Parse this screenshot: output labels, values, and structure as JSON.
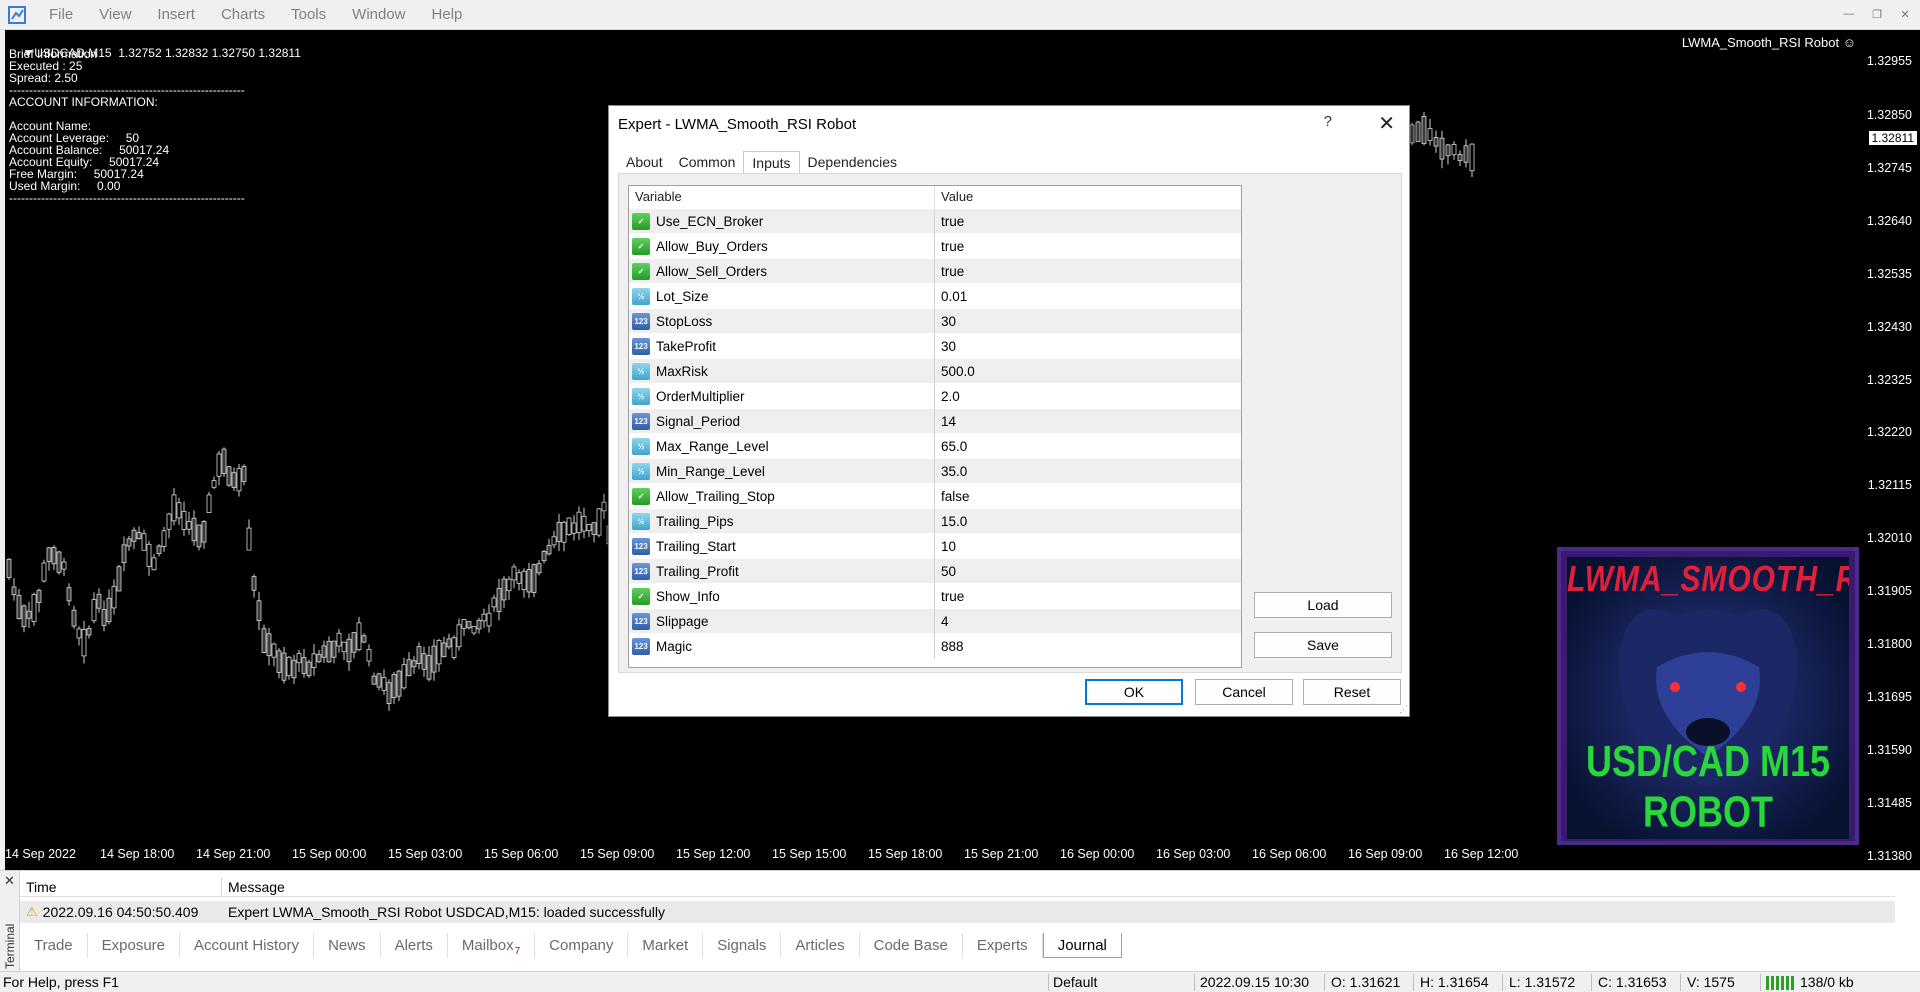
{
  "menubar": {
    "items": [
      "File",
      "View",
      "Insert",
      "Charts",
      "Tools",
      "Window",
      "Help"
    ]
  },
  "chart": {
    "header": "USDCAD,M15  1.32752 1.32832 1.32750 1.32811",
    "info_lines": [
      "Brief Information",
      "Executed : 25",
      "Spread: 2.50",
      "-----------------------------------------------------------",
      "ACCOUNT INFORMATION:",
      "",
      "Account Name:",
      "Account Leverage:     50",
      "Account Balance:     50017.24",
      "Account Equity:     50017.24",
      "Free Margin:     50017.24",
      "Used Margin:     0.00",
      "-----------------------------------------------------------"
    ],
    "ea_label": "LWMA_Smooth_RSI Robot ☺",
    "current_price": "1.32811",
    "price_scale": [
      "1.32955",
      "1.32850",
      "1.32745",
      "1.32640",
      "1.32535",
      "1.32430",
      "1.32325",
      "1.32220",
      "1.32115",
      "1.32010",
      "1.31905",
      "1.31800",
      "1.31695",
      "1.31590",
      "1.31485",
      "1.31380"
    ],
    "time_scale": [
      "14 Sep 2022",
      "14 Sep 18:00",
      "14 Sep 21:00",
      "15 Sep 00:00",
      "15 Sep 03:00",
      "15 Sep 06:00",
      "15 Sep 09:00",
      "15 Sep 12:00",
      "15 Sep 15:00",
      "15 Sep 18:00",
      "15 Sep 21:00",
      "16 Sep 00:00",
      "16 Sep 03:00",
      "16 Sep 06:00",
      "16 Sep 09:00",
      "16 Sep 12:00"
    ],
    "banner": {
      "title": "LWMA_SMOOTH_RSI",
      "subtitle": "USD/CAD M15 ROBOT"
    },
    "colors": {
      "background": "#000000",
      "candle": "#ffffff",
      "banner_title": "#e0203a",
      "banner_subtitle": "#28d83a"
    }
  },
  "dialog": {
    "title": "Expert - LWMA_Smooth_RSI Robot",
    "help": "?",
    "close": "✕",
    "tabs": [
      "About",
      "Common",
      "Inputs",
      "Dependencies"
    ],
    "active_tab": "Inputs",
    "grid_headers": {
      "variable": "Variable",
      "value": "Value"
    },
    "inputs": [
      {
        "name": "Use_ECN_Broker",
        "value": "true",
        "type": "bool",
        "icon": "bool-icon"
      },
      {
        "name": "Allow_Buy_Orders",
        "value": "true",
        "type": "bool",
        "icon": "bool-icon"
      },
      {
        "name": "Allow_Sell_Orders",
        "value": "true",
        "type": "bool",
        "icon": "bool-icon"
      },
      {
        "name": "Lot_Size",
        "value": "0.01",
        "type": "double",
        "icon": "double-icon"
      },
      {
        "name": "StopLoss",
        "value": "30",
        "type": "int",
        "icon": "int-icon"
      },
      {
        "name": "TakeProfit",
        "value": "30",
        "type": "int",
        "icon": "int-icon"
      },
      {
        "name": "MaxRisk",
        "value": "500.0",
        "type": "double",
        "icon": "double-icon"
      },
      {
        "name": "OrderMultiplier",
        "value": "2.0",
        "type": "double",
        "icon": "double-icon"
      },
      {
        "name": "Signal_Period",
        "value": "14",
        "type": "int",
        "icon": "int-icon"
      },
      {
        "name": "Max_Range_Level",
        "value": "65.0",
        "type": "double",
        "icon": "double-icon"
      },
      {
        "name": "Min_Range_Level",
        "value": "35.0",
        "type": "double",
        "icon": "double-icon"
      },
      {
        "name": "Allow_Trailing_Stop",
        "value": "false",
        "type": "bool",
        "icon": "bool-icon"
      },
      {
        "name": "Trailing_Pips",
        "value": "15.0",
        "type": "double",
        "icon": "double-icon"
      },
      {
        "name": "Trailing_Start",
        "value": "10",
        "type": "int",
        "icon": "int-icon"
      },
      {
        "name": "Trailing_Profit",
        "value": "50",
        "type": "int",
        "icon": "int-icon"
      },
      {
        "name": "Show_Info",
        "value": "true",
        "type": "bool",
        "icon": "bool-icon"
      },
      {
        "name": "Slippage",
        "value": "4",
        "type": "int",
        "icon": "int-icon"
      },
      {
        "name": "Magic",
        "value": "888",
        "type": "int",
        "icon": "int-icon"
      }
    ],
    "buttons": {
      "load": "Load",
      "save": "Save",
      "ok": "OK",
      "cancel": "Cancel",
      "reset": "Reset"
    }
  },
  "terminal": {
    "close": "✕",
    "side_label": "Terminal",
    "headers": {
      "time": "Time",
      "message": "Message"
    },
    "row": {
      "time": "2022.09.16 04:50:50.409",
      "message": "Expert LWMA_Smooth_RSI Robot USDCAD,M15: loaded successfully"
    },
    "tabs": [
      "Trade",
      "Exposure",
      "Account History",
      "News",
      "Alerts",
      "Mailbox",
      "Company",
      "Market",
      "Signals",
      "Articles",
      "Code Base",
      "Experts",
      "Journal"
    ],
    "mailbox_badge": "7",
    "active_tab": "Journal"
  },
  "statusbar": {
    "help": "For Help, press F1",
    "profile": "Default",
    "datetime": "2022.09.15 10:30",
    "open": "O: 1.31621",
    "high": "H: 1.31654",
    "low": "L: 1.31572",
    "close": "C: 1.31653",
    "volume": "V: 1575",
    "traffic": "138/0 kb"
  }
}
